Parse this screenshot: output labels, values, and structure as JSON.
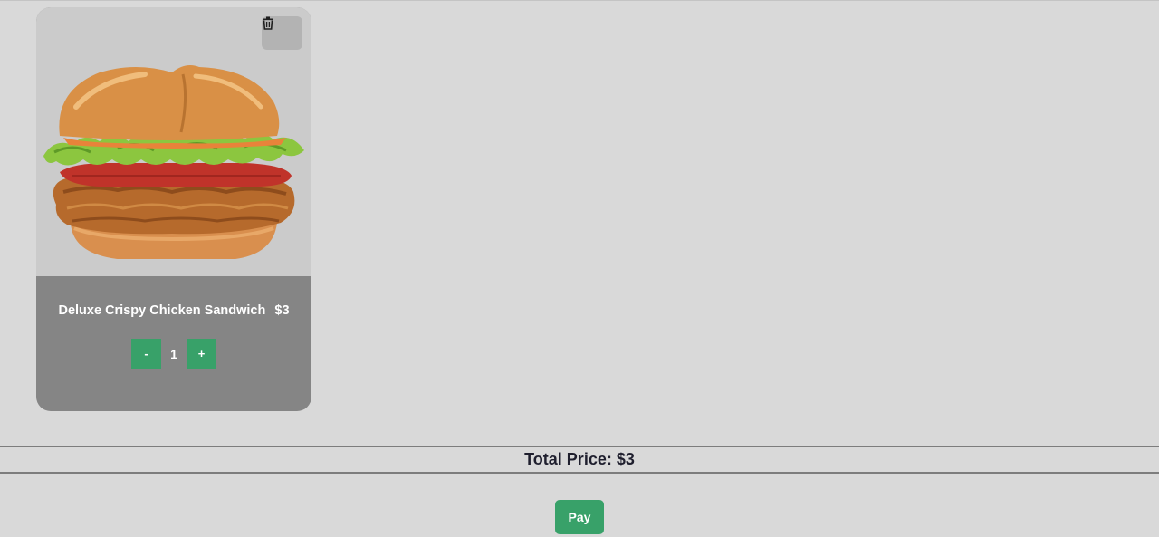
{
  "cart": {
    "items": [
      {
        "name": "Deluxe Crispy Chicken Sandwich",
        "price": "$3",
        "quantity": "1",
        "image_icon": "chicken-sandwich-image",
        "decrement_label": "-",
        "increment_label": "+",
        "delete_icon": "trash-icon"
      }
    ]
  },
  "summary": {
    "total_label": "Total Price: $3"
  },
  "actions": {
    "pay_label": "Pay"
  },
  "colors": {
    "background": "#d9d9d9",
    "card_body": "#858585",
    "card_image_bg": "#cbcbcb",
    "accent_green": "#38a169",
    "text_dark": "#1f1f2e"
  }
}
